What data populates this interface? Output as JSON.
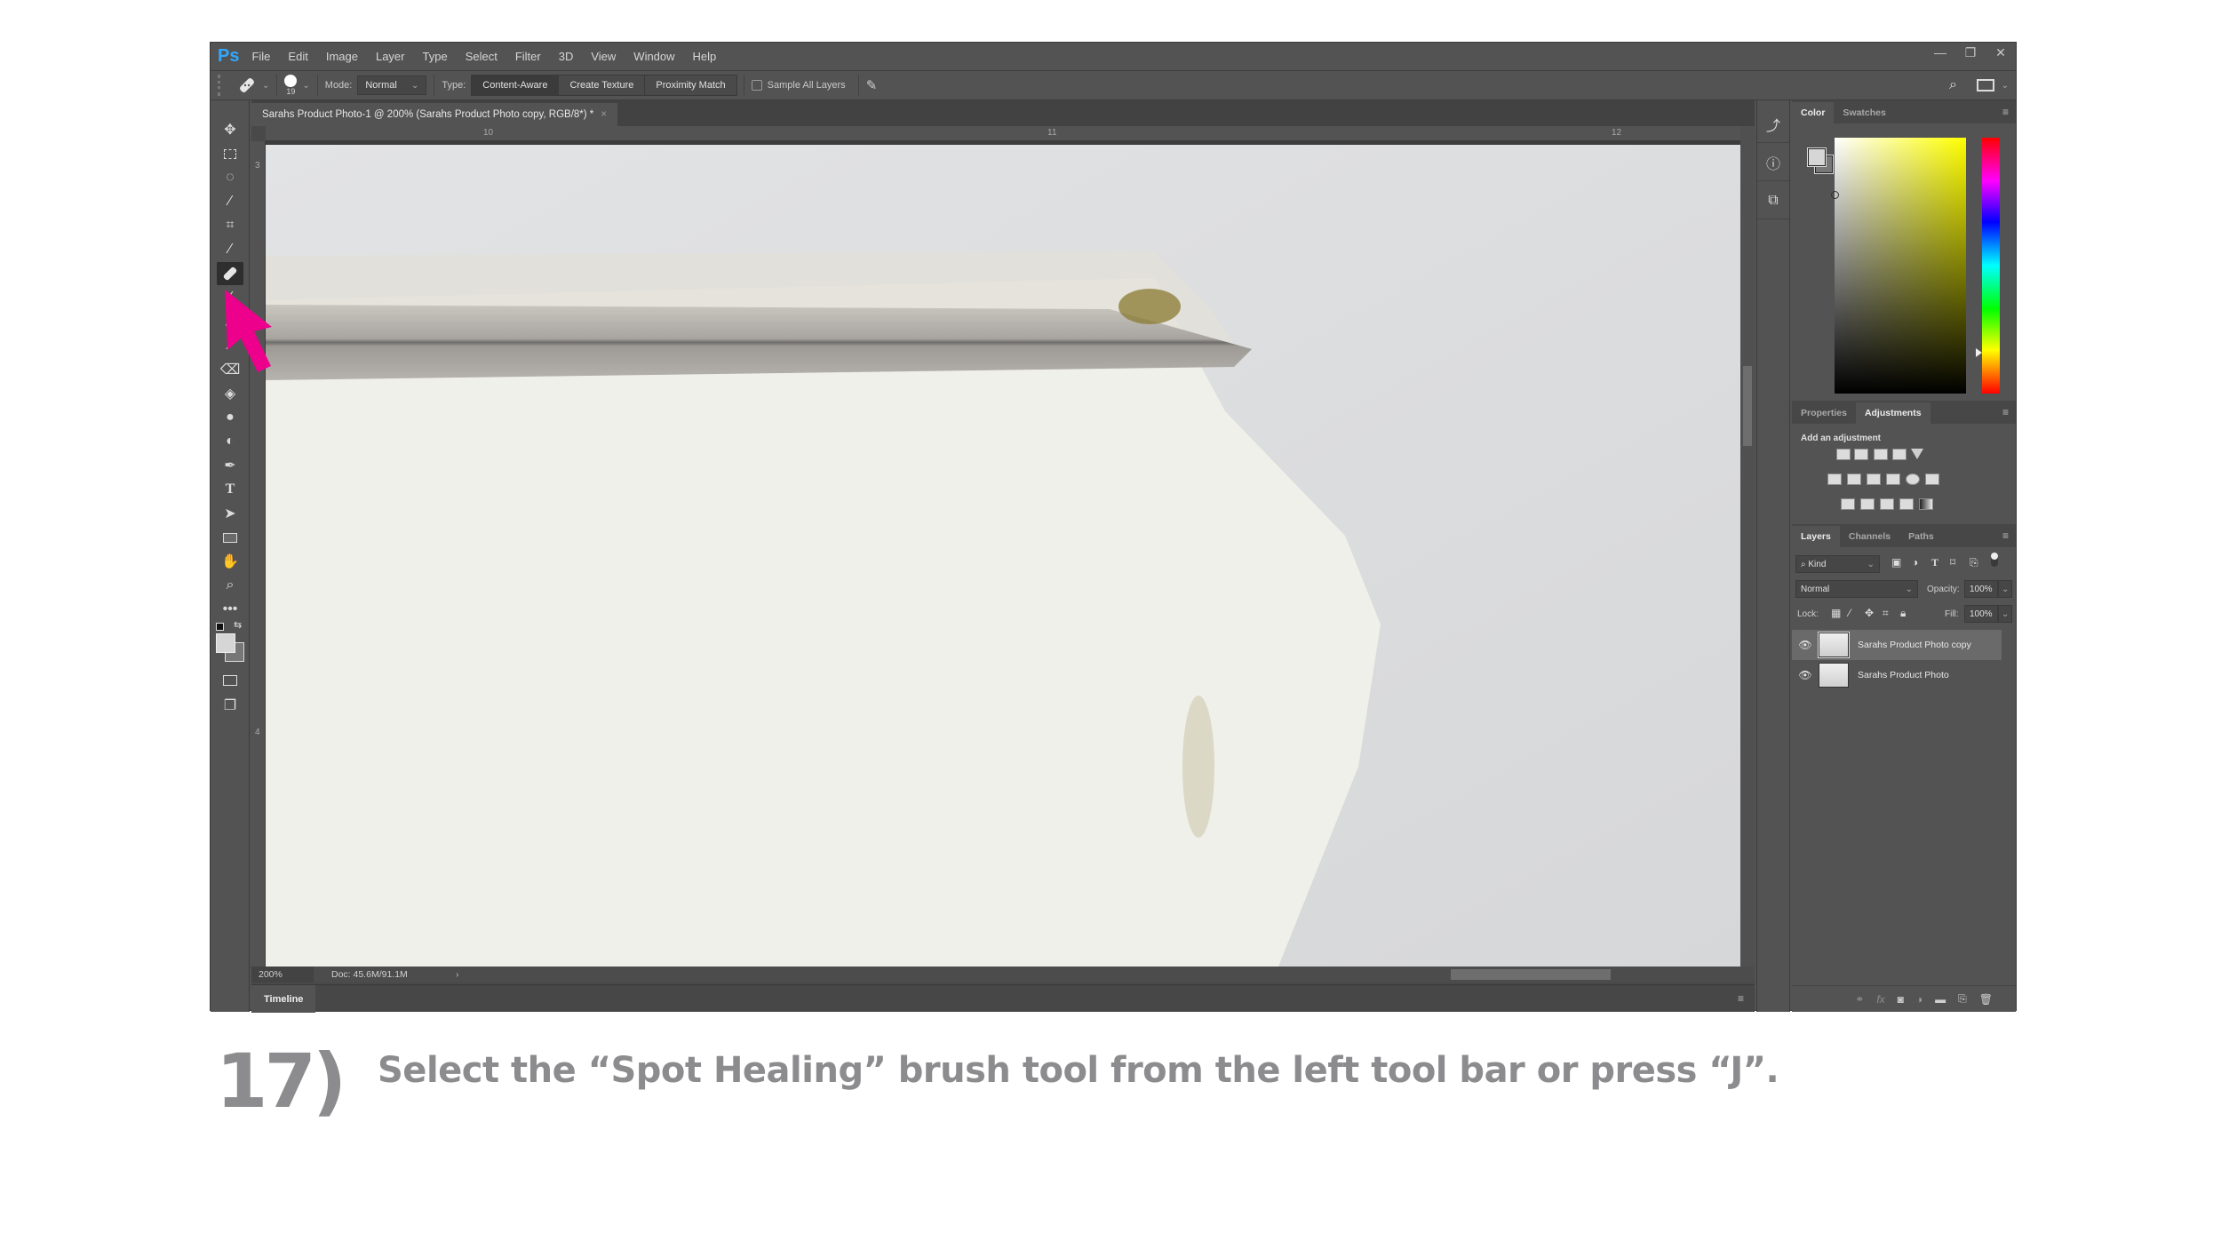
{
  "app": {
    "logo": "Ps",
    "menu": [
      "File",
      "Edit",
      "Image",
      "Layer",
      "Type",
      "Select",
      "Filter",
      "3D",
      "View",
      "Window",
      "Help"
    ],
    "window_controls": {
      "minimize": "—",
      "restore": "❐",
      "close": "✕"
    }
  },
  "options_bar": {
    "brush_size": "19",
    "mode_label": "Mode:",
    "mode_value": "Normal",
    "type_label": "Type:",
    "type_buttons": [
      "Content-Aware",
      "Create Texture",
      "Proximity Match"
    ],
    "type_selected": "Content-Aware",
    "sample_all_layers_label": "Sample All Layers",
    "sample_all_layers_checked": false
  },
  "document": {
    "tab_title": "Sarahs Product Photo-1 @ 200% (Sarahs Product Photo copy, RGB/8*) *",
    "tab_close": "×",
    "ruler_top_labels": [
      "10",
      "11",
      "12"
    ],
    "ruler_left_labels": [
      "3",
      "4"
    ],
    "zoom": "200%",
    "doc_size": "Doc: 45.6M/91.1M"
  },
  "timeline": {
    "label": "Timeline"
  },
  "tools": [
    "move",
    "marquee",
    "lasso",
    "magic-wand",
    "crop",
    "eyedropper",
    "spot-healing-brush",
    "brush",
    "clone-stamp",
    "history-brush",
    "eraser",
    "paint-bucket",
    "blur",
    "dodge",
    "pen",
    "type",
    "path-selection",
    "rectangle",
    "hand",
    "zoom",
    "more"
  ],
  "active_tool": "spot-healing-brush",
  "color_panel": {
    "tabs": [
      "Color",
      "Swatches"
    ],
    "active_tab": "Color",
    "foreground": "#d6d6d6",
    "background": "#777777",
    "hue_color": "#ffff00"
  },
  "adjustments_panel": {
    "tabs": [
      "Properties",
      "Adjustments"
    ],
    "active_tab": "Adjustments",
    "heading": "Add an adjustment",
    "icons_row1": [
      "brightness-contrast",
      "levels",
      "curves",
      "exposure",
      "vibrance"
    ],
    "icons_row2": [
      "hue-saturation",
      "color-balance",
      "black-white",
      "photo-filter",
      "channel-mixer",
      "color-lookup"
    ],
    "icons_row3": [
      "invert",
      "posterize",
      "threshold",
      "selective-color",
      "gradient-map"
    ]
  },
  "layers_panel": {
    "tabs": [
      "Layers",
      "Channels",
      "Paths"
    ],
    "active_tab": "Layers",
    "filter_kind": "Kind",
    "blend_mode": "Normal",
    "opacity_label": "Opacity:",
    "opacity": "100%",
    "lock_label": "Lock:",
    "fill_label": "Fill:",
    "fill": "100%",
    "layers": [
      {
        "name": "Sarahs Product Photo copy",
        "visible": true,
        "selected": true
      },
      {
        "name": "Sarahs Product Photo",
        "visible": true,
        "selected": false
      }
    ]
  },
  "annotation": {
    "color": "#ec008c"
  },
  "caption": {
    "step": "17)",
    "text": "Select the “Spot Healing” brush tool from the left tool bar or press “J”."
  }
}
